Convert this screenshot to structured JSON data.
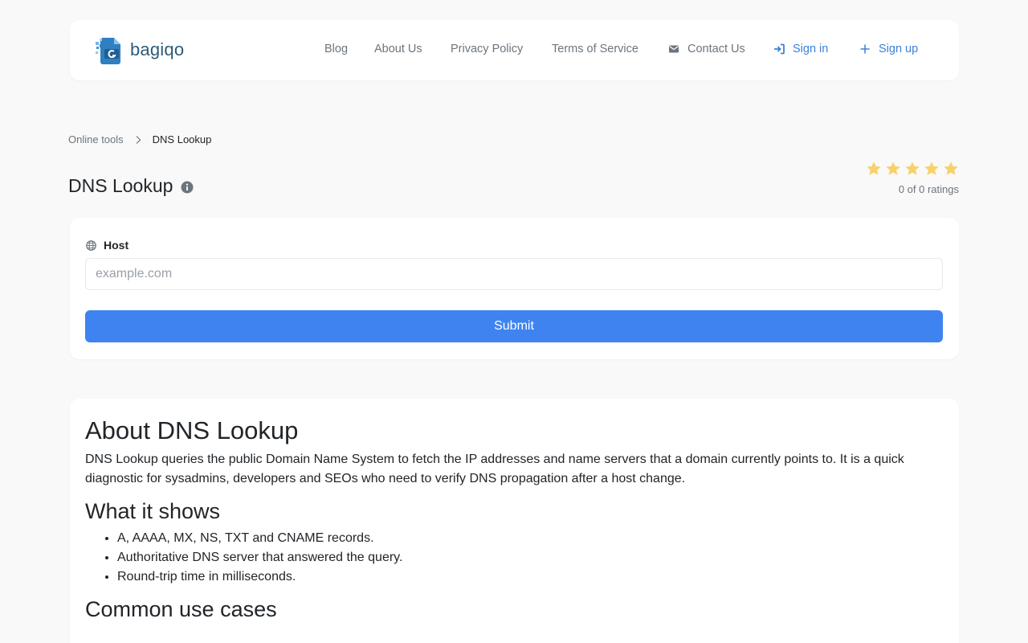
{
  "brand": {
    "name": "bagiqo"
  },
  "nav": {
    "blog": "Blog",
    "about": "About Us",
    "privacy": "Privacy Policy",
    "terms": "Terms of Service",
    "contact": "Contact Us",
    "signin": "Sign in",
    "signup": "Sign up"
  },
  "breadcrumb": {
    "parent": "Online tools",
    "current": "DNS Lookup"
  },
  "title": "DNS Lookup",
  "rating": {
    "stars": 5,
    "average": 0,
    "count": 0,
    "text": "0 of 0 ratings"
  },
  "form": {
    "host_label": "Host",
    "host_placeholder": "example.com",
    "host_value": "",
    "submit": "Submit"
  },
  "about": {
    "heading": "About DNS Lookup",
    "description": "DNS Lookup queries the public Domain Name System to fetch the IP addresses and name servers that a domain currently points to. It is a quick diagnostic for sysadmins, developers and SEOs who need to verify DNS propagation after a host change.",
    "shows_heading": "What it shows",
    "shows_items": [
      "A, AAAA, MX, NS, TXT and CNAME records.",
      "Authoritative DNS server that answered the query.",
      "Round-trip time in milliseconds."
    ],
    "use_cases_heading": "Common use cases"
  },
  "colors": {
    "accent": "#3b82d6",
    "button": "#3f83f0",
    "star": "#f7d26b",
    "muted": "#6c757d"
  },
  "icons": [
    "logo-icon",
    "envelope-icon",
    "sign-in-icon",
    "plus-icon",
    "chevron-right-icon",
    "info-icon",
    "star-icon",
    "globe-icon"
  ]
}
